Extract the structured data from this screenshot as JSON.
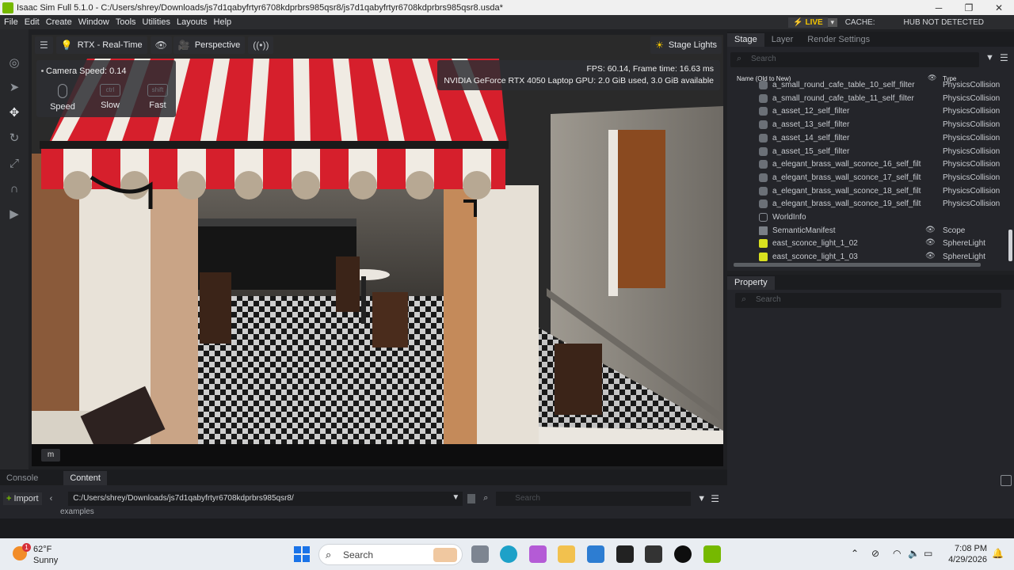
{
  "window": {
    "title": "Isaac Sim Full 5.1.0 - C:/Users/shrey/Downloads/js7d1qabyfrtyr6708kdprbrs985qsr8/js7d1qabyfrtyr6708kdprbrs985qsr8.usda*",
    "minimize": "─",
    "maximize": "❐",
    "close": "✕"
  },
  "menu": {
    "items": [
      "File",
      "Edit",
      "Create",
      "Window",
      "Tools",
      "Utilities",
      "Layouts",
      "Help"
    ],
    "live_label": "LIVE",
    "cache_label": "CACHE:",
    "hub_status": "HUB NOT DETECTED"
  },
  "viewport": {
    "toolbar": {
      "render_mode": "RTX - Real-Time",
      "camera": "Perspective",
      "stage_lights": "Stage Lights"
    },
    "camera_speed": {
      "title": "Camera Speed: 0.14",
      "speed_label": "Speed",
      "slow_key": "ctrl",
      "slow_label": "Slow",
      "fast_key": "shift",
      "fast_label": "Fast"
    },
    "stats": {
      "fps_line": "FPS: 60.14, Frame time: 16.63 ms",
      "gpu_line": "NVIDIA GeForce RTX 4050 Laptop GPU: 2.0 GiB used, 3.0 GiB available"
    },
    "footer_key": "m"
  },
  "stage": {
    "tabs": [
      "Stage",
      "Layer",
      "Render Settings"
    ],
    "search_placeholder": "Search",
    "col_name": "Name (Old to New)",
    "col_type": "Type",
    "rows": [
      {
        "name": "a_small_round_cafe_table_10_self_filter",
        "type": "PhysicsCollision",
        "icon": "cube"
      },
      {
        "name": "a_small_round_cafe_table_11_self_filter",
        "type": "PhysicsCollision",
        "icon": "cube"
      },
      {
        "name": "a_asset_12_self_filter",
        "type": "PhysicsCollision",
        "icon": "cube"
      },
      {
        "name": "a_asset_13_self_filter",
        "type": "PhysicsCollision",
        "icon": "cube"
      },
      {
        "name": "a_asset_14_self_filter",
        "type": "PhysicsCollision",
        "icon": "cube"
      },
      {
        "name": "a_asset_15_self_filter",
        "type": "PhysicsCollision",
        "icon": "cube"
      },
      {
        "name": "a_elegant_brass_wall_sconce_16_self_filt",
        "type": "PhysicsCollision",
        "icon": "cube"
      },
      {
        "name": "a_elegant_brass_wall_sconce_17_self_filt",
        "type": "PhysicsCollision",
        "icon": "cube"
      },
      {
        "name": "a_elegant_brass_wall_sconce_18_self_filt",
        "type": "PhysicsCollision",
        "icon": "cube"
      },
      {
        "name": "a_elegant_brass_wall_sconce_19_self_filt",
        "type": "PhysicsCollision",
        "icon": "cube"
      },
      {
        "name": "WorldInfo",
        "type": "",
        "icon": "world"
      },
      {
        "name": "SemanticManifest",
        "type": "Scope",
        "icon": "folder"
      },
      {
        "name": "east_sconce_light_1_02",
        "type": "SphereLight",
        "icon": "light"
      },
      {
        "name": "east_sconce_light_1_03",
        "type": "SphereLight",
        "icon": "light"
      }
    ]
  },
  "property": {
    "tab": "Property",
    "search_placeholder": "Search"
  },
  "bottom": {
    "tabs": [
      "Console",
      "Content"
    ],
    "import_label": "Import",
    "path": "C:/Users/shrey/Downloads/js7d1qabyfrtyr6708kdprbrs985qsr8/",
    "search_placeholder": "Search",
    "folder_item": "examples"
  },
  "taskbar": {
    "temperature": "62°F",
    "condition": "Sunny",
    "notification_count": "1",
    "search_placeholder": "Search",
    "time": "7:08 PM",
    "date": "4/29/2026"
  }
}
